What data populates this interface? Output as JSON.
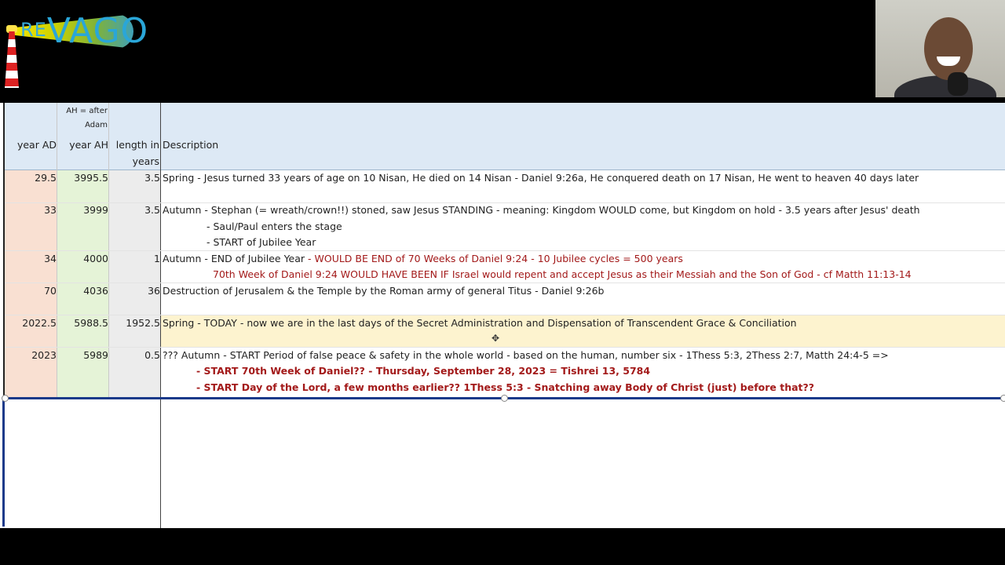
{
  "logo": {
    "text_small": "RE",
    "text_large": "VAGO"
  },
  "header": {
    "note_ah": "AH = after Adam",
    "col_year_ad": "year AD",
    "col_year_ah": "year AH",
    "col_length": "length in years",
    "col_desc": "Description"
  },
  "rows": [
    {
      "ad": "29.5",
      "ah": "3995.5",
      "len": "3.5",
      "lines": [
        {
          "text": "Spring - Jesus turned 33 years of age on 10 Nisan, He died on 14 Nisan - Daniel 9:26a, He conquered death on 17 Nisan, He went to heaven 40 days later"
        }
      ]
    },
    {
      "ad": "33",
      "ah": "3999",
      "len": "3.5",
      "lines": [
        {
          "text": "Autumn - Stephan (= wreath/crown!!) stoned, saw Jesus STANDING - meaning: Kingdom WOULD come, but Kingdom on hold - 3.5 years after Jesus' death"
        },
        {
          "text": "- Saul/Paul enters the stage"
        },
        {
          "text": "- START of Jubilee Year"
        }
      ]
    },
    {
      "ad": "34",
      "ah": "4000",
      "len": "1",
      "lines": [
        {
          "text": "Autumn - END of Jubilee Year ",
          "red": "- WOULD BE END of 70 Weeks of Daniel 9:24 - 10 Jubilee cycles = 500 years"
        },
        {
          "red": "70th Week of Daniel 9:24 WOULD HAVE BEEN IF Israel would repent and accept Jesus as their Messiah and the Son of God - cf Matth 11:13-14"
        }
      ]
    },
    {
      "ad": "70",
      "ah": "4036",
      "len": "36",
      "lines": [
        {
          "text": "Destruction of Jerusalem & the Temple by the Roman army of general Titus - Daniel 9:26b"
        }
      ]
    },
    {
      "ad": "2022.5",
      "ah": "5988.5",
      "len": "1952.5",
      "lines": [
        {
          "text": "Spring - TODAY - now we are in the last days of the Secret Administration and Dispensation of Transcendent Grace & Conciliation"
        }
      ]
    },
    {
      "ad": "2023",
      "ah": "5989",
      "len": "0.5",
      "lines": [
        {
          "text": "??? Autumn - START Period of false peace & safety in the whole world - based on the human, number six - 1Thess 5:3, 2Thess 2:7, Matth 24:4-5 =>"
        },
        {
          "red": "- START 70th Week of Daniel?? - Thursday, September 28, 2023 = Tishrei 13, 5784"
        },
        {
          "red": "- START Day of the Lord, a few months earlier?? 1Thess 5:3 - Snatching away Body of Christ (just) before that??"
        }
      ]
    }
  ],
  "colors": {
    "year_ad_bg": "#f9e0d2",
    "year_ah_bg": "#e5f3d7",
    "length_bg": "#ececec",
    "header_bg": "#dde9f5",
    "today_row_bg": "#fdf3cf",
    "red_text": "#a31a1a",
    "selection": "#1a3a8a"
  }
}
